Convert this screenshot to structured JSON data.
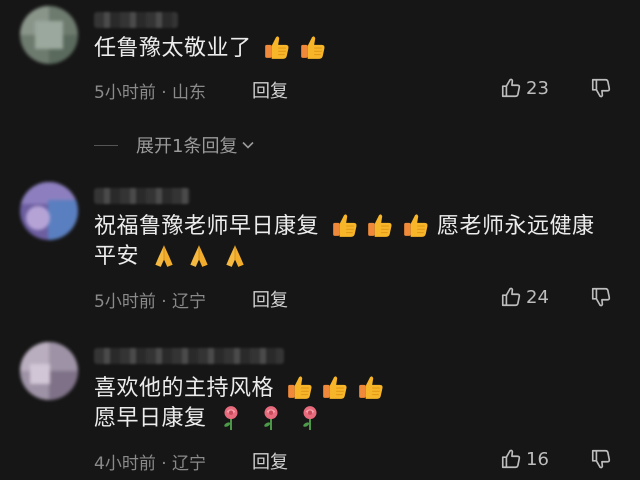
{
  "comments": [
    {
      "text_lines": [
        "任鲁豫太敬业了"
      ],
      "emoji": [
        "thumbs-up",
        "thumbs-up"
      ],
      "time": "5小时前",
      "location": "山东",
      "reply_label": "回复",
      "likes": "23",
      "expand_label": "展开1条回复"
    },
    {
      "text_lines": [
        "祝福鲁豫老师早日康复",
        "愿老师永远健康",
        "平安"
      ],
      "emoji_line1": [
        "thumbs-up",
        "thumbs-up",
        "thumbs-up"
      ],
      "emoji_line2": [
        "folded-hands",
        "folded-hands",
        "folded-hands"
      ],
      "time": "5小时前",
      "location": "辽宁",
      "reply_label": "回复",
      "likes": "24"
    },
    {
      "text_lines": [
        "喜欢他的主持风格",
        "愿早日康复"
      ],
      "emoji_line1": [
        "thumbs-up",
        "thumbs-up",
        "thumbs-up"
      ],
      "emoji_line2": [
        "rose",
        "rose",
        "rose"
      ],
      "time": "4小时前",
      "location": "辽宁",
      "reply_label": "回复",
      "likes": "16"
    }
  ],
  "separator": "·",
  "colors": {
    "background": "#161616",
    "text": "#ececec",
    "meta": "#8a8a8a",
    "emoji_thumb": "#f7b529",
    "emoji_rose": "#e76b7c"
  },
  "icons": {
    "like": "thumb-up-outline-icon",
    "dislike": "thumb-down-outline-icon",
    "expand": "chevron-down-icon"
  }
}
